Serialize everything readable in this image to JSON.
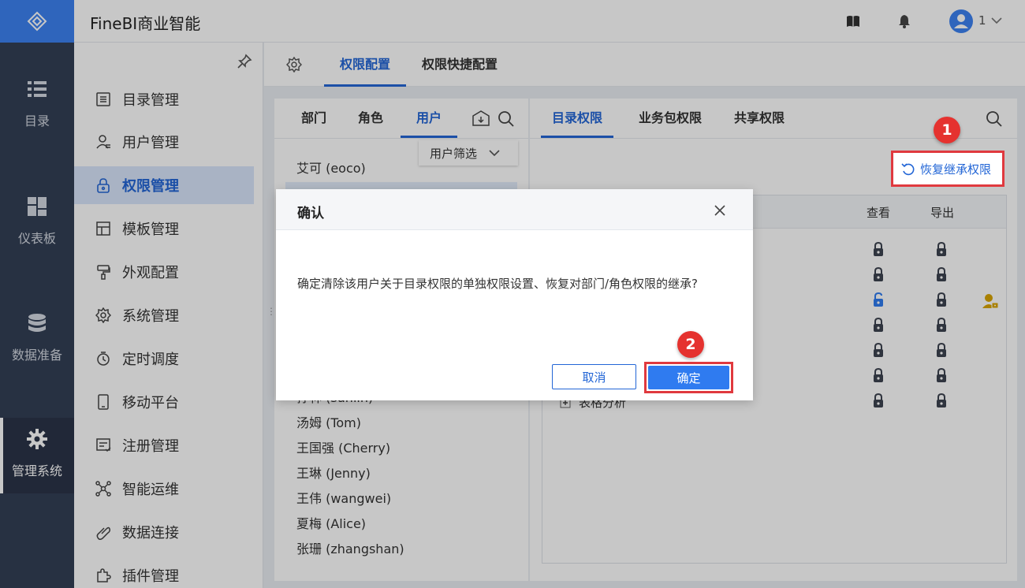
{
  "app": {
    "title": "FineBI商业智能",
    "user_name": "1"
  },
  "rail": [
    {
      "label": "目录",
      "icon": "list-icon"
    },
    {
      "label": "仪表板",
      "icon": "dashboard-icon"
    },
    {
      "label": "数据准备",
      "icon": "database-icon"
    },
    {
      "label": "管理系统",
      "icon": "gear-icon",
      "active": true
    }
  ],
  "menu": [
    {
      "label": "目录管理",
      "icon": "catalog-icon"
    },
    {
      "label": "用户管理",
      "icon": "user-icon"
    },
    {
      "label": "权限管理",
      "icon": "lock-icon",
      "active": true
    },
    {
      "label": "模板管理",
      "icon": "template-icon"
    },
    {
      "label": "外观配置",
      "icon": "brush-icon"
    },
    {
      "label": "系统管理",
      "icon": "gear-icon"
    },
    {
      "label": "定时调度",
      "icon": "timer-icon"
    },
    {
      "label": "移动平台",
      "icon": "mobile-icon"
    },
    {
      "label": "注册管理",
      "icon": "register-icon"
    },
    {
      "label": "智能运维",
      "icon": "ops-icon"
    },
    {
      "label": "数据连接",
      "icon": "link-icon"
    },
    {
      "label": "插件管理",
      "icon": "plugin-icon"
    }
  ],
  "top_tabs": [
    {
      "label": "权限配置",
      "active": true
    },
    {
      "label": "权限快捷配置"
    }
  ],
  "mid": {
    "tabs": [
      {
        "label": "部门"
      },
      {
        "label": "角色"
      },
      {
        "label": "用户",
        "active": true
      }
    ],
    "filter_label": "用户筛选",
    "users_top": [
      "艾可 (eoco)"
    ],
    "users_bottom": [
      "汤姆 (Tom)",
      "王国强 (Cherry)",
      "王琳 (Jenny)",
      "王伟 (wangwei)",
      "夏梅 (Alice)",
      "张珊 (zhangshan)"
    ],
    "partial_user": "孙林 (sunlin)"
  },
  "right": {
    "tabs": [
      {
        "label": "目录权限",
        "active": true
      },
      {
        "label": "业务包权限"
      },
      {
        "label": "共享权限"
      }
    ],
    "restore_label": "恢复继承权限",
    "col_view": "查看",
    "col_export": "导出",
    "partial_row": "表格分析",
    "lock_rows": [
      "locked",
      "locked",
      "unlocked",
      "locked",
      "locked",
      "locked",
      "locked"
    ]
  },
  "dialog": {
    "title": "确认",
    "message": "确定清除该用户关于目录权限的单独权限设置、恢复对部门/角色权限的继承?",
    "cancel": "取消",
    "confirm": "确定"
  },
  "annotations": {
    "step1": "1",
    "step2": "2"
  },
  "colors": {
    "accent": "#2366d6",
    "rail": "#333f55",
    "highlight_box": "#e0393e"
  }
}
